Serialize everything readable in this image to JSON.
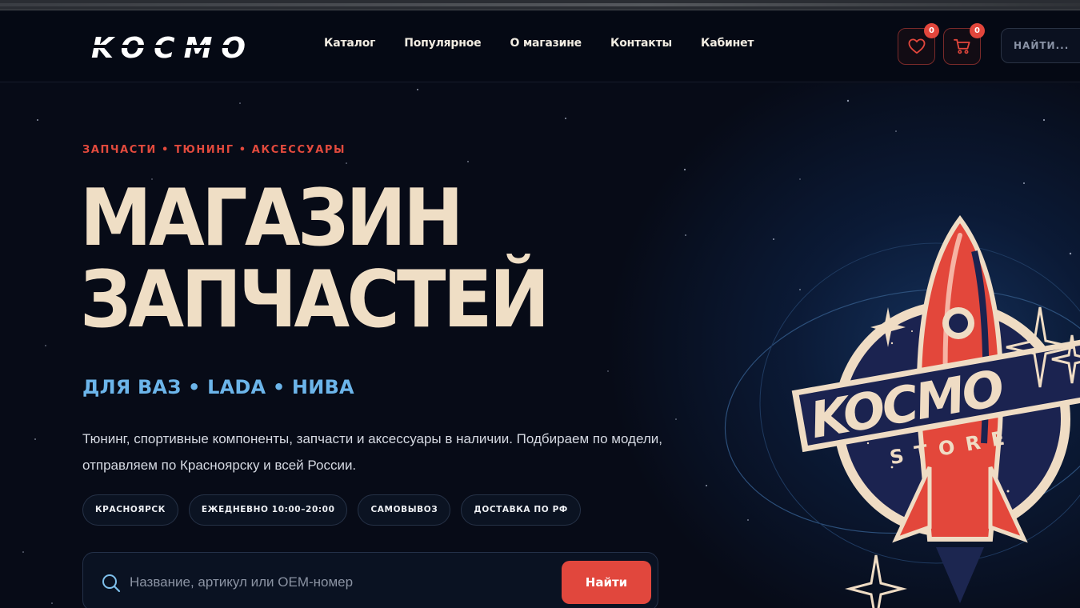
{
  "brand": {
    "logo_text": "KOCMO"
  },
  "nav": {
    "items": [
      {
        "label": "Каталог"
      },
      {
        "label": "Популярное"
      },
      {
        "label": "О магазине"
      },
      {
        "label": "Контакты"
      },
      {
        "label": "Кабинет"
      }
    ]
  },
  "header_actions": {
    "wishlist_count": "0",
    "cart_count": "0",
    "search_placeholder": "НАЙТИ..."
  },
  "hero": {
    "eyebrow": "ЗАПЧАСТИ • ТЮНИНГ • АКСЕССУАРЫ",
    "headline_line1": "МАГАЗИН",
    "headline_line2": "ЗАПЧАСТЕЙ",
    "subhead": "ДЛЯ ВАЗ • LADA • НИВА",
    "description": "Тюнинг, спортивные компоненты, запчасти и аксессуары в наличии. Подбираем по модели, отправляем по Красноярску и всей России.",
    "chips": [
      {
        "label": "КРАСНОЯРСК"
      },
      {
        "label": "ЕЖЕДНЕВНО 10:00–20:00"
      },
      {
        "label": "САМОВЫВОЗ"
      },
      {
        "label": "ДОСТАВКА ПО РФ"
      }
    ],
    "search": {
      "placeholder": "Название, артикул или OEM-номер",
      "button_label": "Найти"
    }
  },
  "emblem": {
    "title": "KOCMO",
    "subtitle": "STORE"
  },
  "colors": {
    "accent_red": "#e1473d",
    "cream": "#efdec5",
    "sky_blue": "#6cb5ea",
    "navy_bg": "#070b17"
  },
  "icons": [
    "heart-icon",
    "cart-icon",
    "search-icon",
    "rocket-emblem"
  ]
}
